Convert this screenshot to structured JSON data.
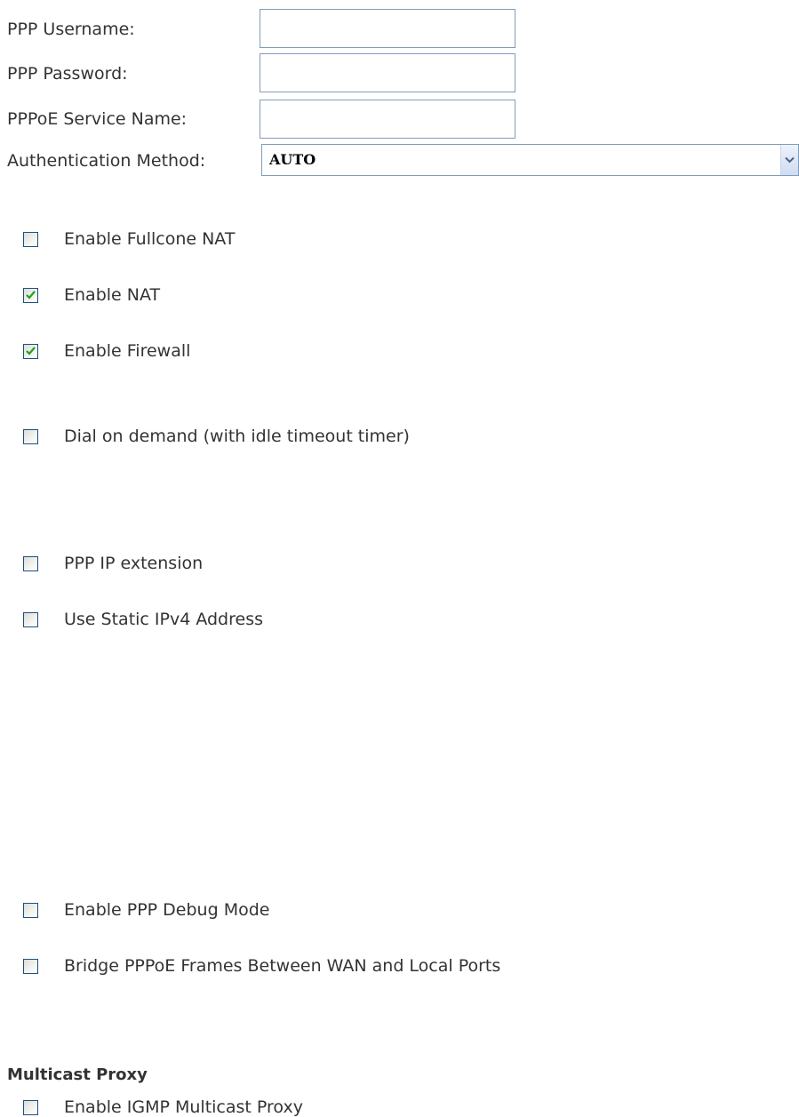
{
  "form": {
    "ppp_username": {
      "label": "PPP Username:",
      "value": ""
    },
    "ppp_password": {
      "label": "PPP Password:",
      "value": ""
    },
    "pppoe_service_name": {
      "label": "PPPoE Service Name:",
      "value": ""
    },
    "auth_method": {
      "label": "Authentication Method:",
      "value": "AUTO",
      "icon": "chevron-down-icon"
    }
  },
  "checkboxes": {
    "fullcone_nat": {
      "label": "Enable Fullcone NAT",
      "checked": false
    },
    "nat": {
      "label": "Enable NAT",
      "checked": true
    },
    "firewall": {
      "label": "Enable Firewall",
      "checked": true
    },
    "dial_on_demand": {
      "label": "Dial on demand (with idle timeout timer)",
      "checked": false
    },
    "ppp_ip_extension": {
      "label": "PPP IP extension",
      "checked": false
    },
    "static_ipv4": {
      "label": "Use Static IPv4 Address",
      "checked": false
    },
    "ppp_debug": {
      "label": "Enable PPP Debug Mode",
      "checked": false
    },
    "bridge_pppoe": {
      "label": "Bridge PPPoE Frames Between WAN and Local Ports",
      "checked": false
    }
  },
  "multicast": {
    "title": "Multicast Proxy",
    "igmp_proxy": {
      "label": "Enable IGMP Multicast Proxy",
      "checked": false
    }
  },
  "colors": {
    "text": "#333333",
    "input_border": "#7f9db9",
    "checkbox_border": "#1c5180",
    "check_mark": "#21a121"
  }
}
